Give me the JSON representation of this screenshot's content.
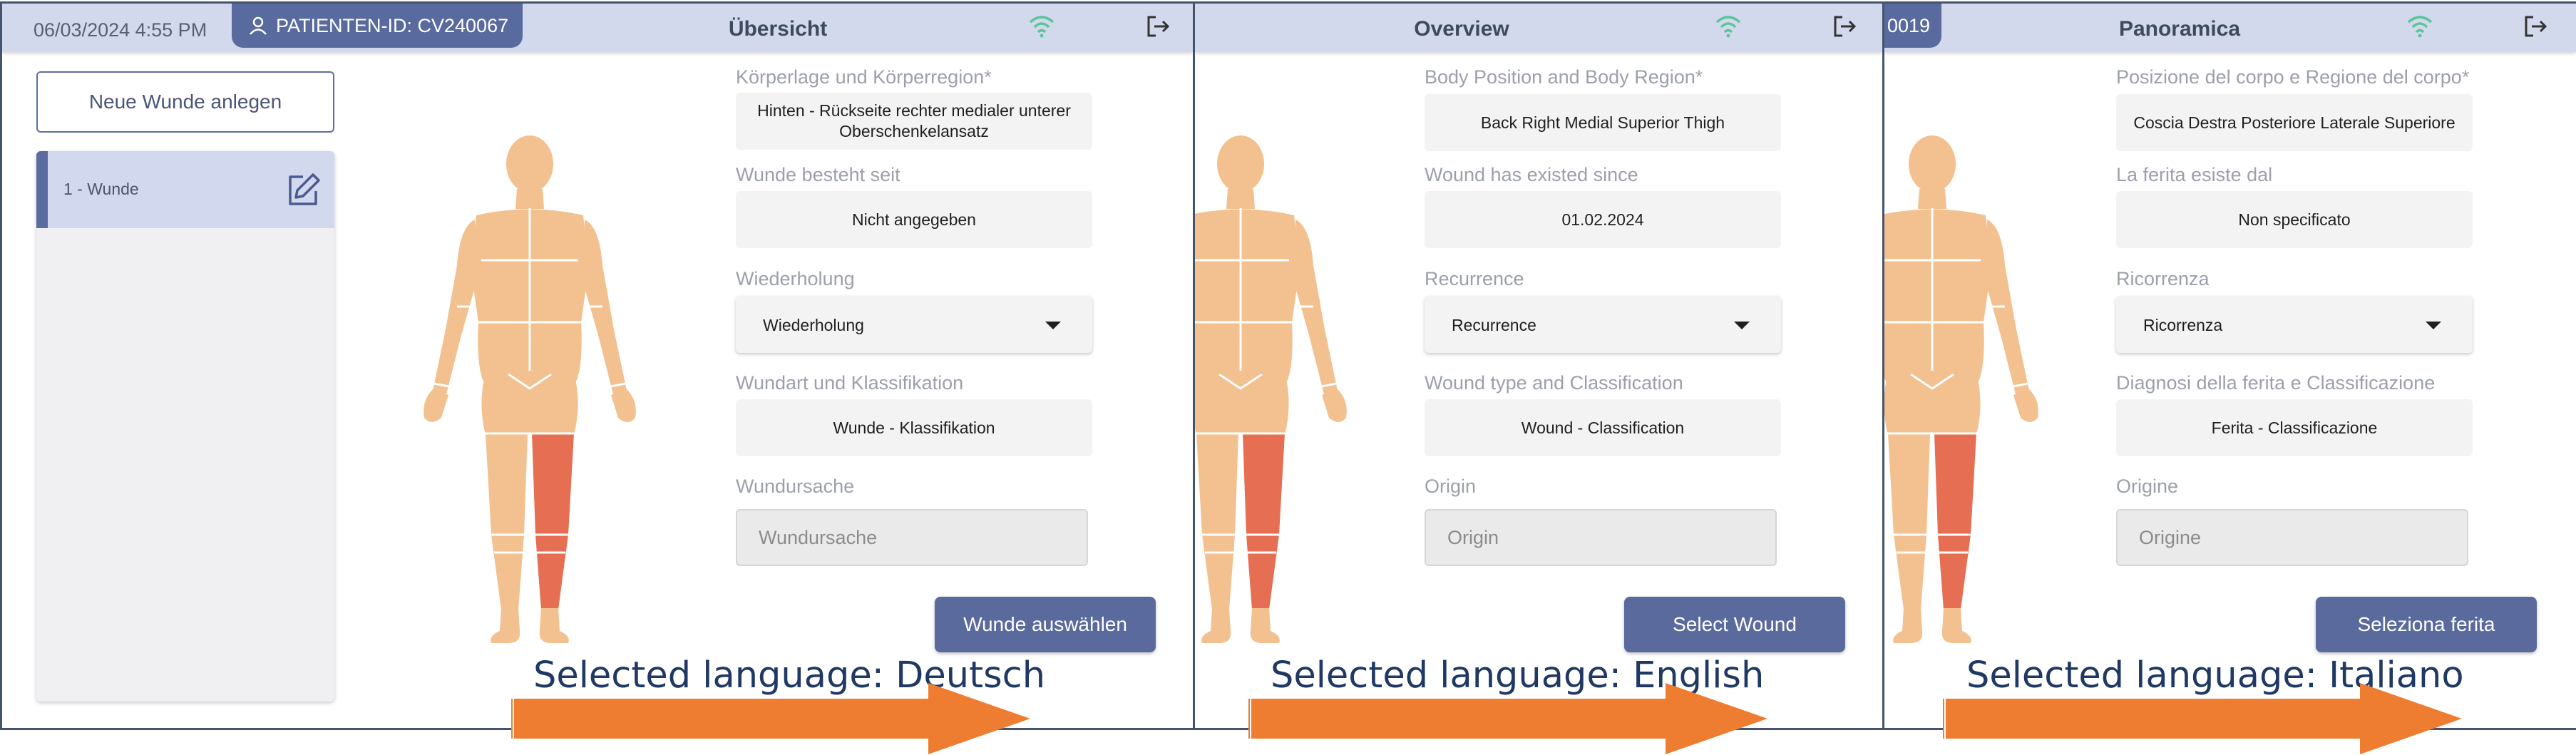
{
  "colors": {
    "topbar": "#d3d9ec",
    "accent": "#5a6a9d",
    "frame": "#44546f",
    "wifi": "#5dc49a",
    "body_skin": "#f3c08f",
    "body_selected": "#e66e52",
    "arrow": "#ee7d31",
    "caption": "#1f3864"
  },
  "panels": [
    {
      "datetime": "06/03/2024 4:55 PM",
      "patient_id": "PATIENTEN-ID: CV240067",
      "title": "Übersicht",
      "new_wound_button": "Neue Wunde anlegen",
      "wound_item": "1 - Wunde",
      "body_position_label": "Körperlage und Körperregion*",
      "body_position_value": "Hinten - Rückseite rechter medialer unterer Oberschenkelansatz",
      "since_label": "Wunde besteht seit",
      "since_value": "Nicht angegeben",
      "recurrence_label": "Wiederholung",
      "recurrence_value": "Wiederholung",
      "type_label": "Wundart und Klassifikation",
      "type_value": "Wunde - Klassifikation",
      "origin_label": "Wundursache",
      "origin_placeholder": "Wundursache",
      "select_button": "Wunde auswählen",
      "caption": "Selected language: Deutsch"
    },
    {
      "title": "Overview",
      "body_position_label": "Body Position and Body Region*",
      "body_position_value": "Back Right Medial Superior Thigh",
      "since_label": "Wound has existed since",
      "since_value": "01.02.2024",
      "recurrence_label": "Recurrence",
      "recurrence_value": "Recurrence",
      "type_label": "Wound type and Classification",
      "type_value": "Wound - Classification",
      "origin_label": "Origin",
      "origin_placeholder": "Origin",
      "select_button": "Select Wound",
      "caption": "Selected language: English"
    },
    {
      "patient_id": "0019",
      "title": "Panoramica",
      "body_position_label": "Posizione del corpo e Regione del corpo*",
      "body_position_value": "Coscia Destra Posteriore Laterale Superiore",
      "since_label": "La ferita esiste dal",
      "since_value": "Non specificato",
      "recurrence_label": "Ricorrenza",
      "recurrence_value": "Ricorrenza",
      "type_label": "Diagnosi della ferita e Classificazione",
      "type_value": "Ferita - Classificazione",
      "origin_label": "Origine",
      "origin_placeholder": "Origine",
      "select_button": "Seleziona ferita",
      "caption": "Selected language: Italiano"
    }
  ]
}
